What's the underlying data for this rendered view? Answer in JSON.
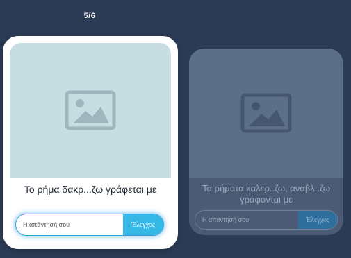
{
  "progress": {
    "text": "5/6"
  },
  "cards": [
    {
      "prompt": "Το ρήμα δακρ...ζω γράφεται με",
      "input_placeholder": "Η απάντησή σου",
      "input_value": "",
      "check_label": "Έλεγχος",
      "image_icon": "image-placeholder-icon"
    },
    {
      "prompt": "Τα ρήματα καλερ..ζω, αναβλ..ζω γράφονται με",
      "input_placeholder": "Η απάντησή σου",
      "input_value": "",
      "check_label": "Έλεγχος",
      "image_icon": "image-placeholder-icon"
    }
  ],
  "colors": {
    "background": "#2c3b55",
    "accent": "#35b8e6",
    "active_card": "#ffffff",
    "image_bg": "#c8dde2"
  }
}
